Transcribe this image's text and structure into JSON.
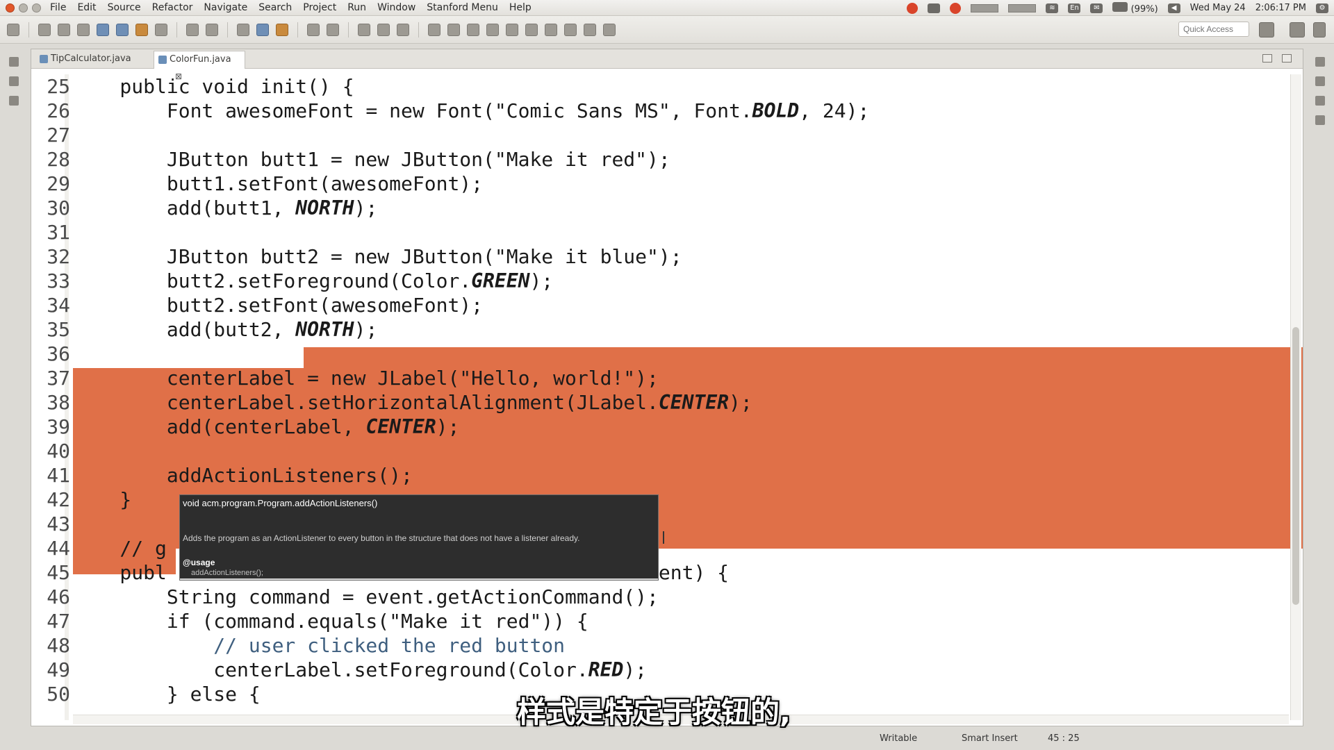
{
  "menubar": {
    "items": [
      "File",
      "Edit",
      "Source",
      "Refactor",
      "Navigate",
      "Search",
      "Project",
      "Run",
      "Window",
      "Stanford Menu",
      "Help"
    ],
    "battery": "(99%)",
    "date": "Wed May 24",
    "time": "2:06:17 PM"
  },
  "toolbar": {
    "quick_access_placeholder": "Quick Access"
  },
  "tabs": [
    {
      "label": "TipCalculator.java",
      "active": false
    },
    {
      "label": "ColorFun.java",
      "active": true,
      "close": "⊠"
    }
  ],
  "editor": {
    "line_numbers": [
      "25",
      "26",
      "27",
      "28",
      "29",
      "30",
      "31",
      "32",
      "33",
      "34",
      "35",
      "36",
      "37",
      "38",
      "39",
      "40",
      "41",
      "42",
      "43",
      "44",
      "45",
      "46",
      "47",
      "48",
      "49",
      "50"
    ],
    "lines": [
      {
        "plain": "    public void init() {"
      },
      {
        "plain": "        Font awesomeFont = new Font(\"Comic Sans MS\", Font.",
        "italic": "BOLD",
        "after": ", 24);"
      },
      {
        "plain": ""
      },
      {
        "plain": "        JButton butt1 = new JButton(\"Make it red\");"
      },
      {
        "plain": "        butt1.setFont(awesomeFont);"
      },
      {
        "plain": "        add(butt1, ",
        "italic": "NORTH",
        "after": ");"
      },
      {
        "plain": ""
      },
      {
        "plain": "        JButton butt2 = new JButton(\"Make it blue\");"
      },
      {
        "plain": "        butt2.setForeground(Color.",
        "italic": "GREEN",
        "after": ");"
      },
      {
        "plain": "        butt2.setFont(awesomeFont);"
      },
      {
        "plain": "        add(butt2, ",
        "italic": "NORTH",
        "after": ");"
      },
      {
        "plain": ""
      },
      {
        "plain": "        centerLabel = new JLabel(\"Hello, world!\");"
      },
      {
        "plain": "        centerLabel.setHorizontalAlignment(JLabel.",
        "italic": "CENTER",
        "after": ");"
      },
      {
        "plain": "        add(centerLabel, ",
        "italic": "CENTER",
        "after": ");"
      },
      {
        "plain": ""
      },
      {
        "plain": "        addActionListeners();"
      },
      {
        "plain": "    }"
      },
      {
        "plain": ""
      },
      {
        "plain": "    // g"
      },
      {
        "plain": "    publ",
        "after": "                                        event) {"
      },
      {
        "plain": "        String command = event.getActionCommand();"
      },
      {
        "plain": "        if (command.equals(\"Make it red\")) {"
      },
      {
        "plain": "            // user clicked the red button"
      },
      {
        "plain": "            centerLabel.setForeground(Color.",
        "italic": "RED",
        "after": ");"
      },
      {
        "plain": "        } else {"
      }
    ]
  },
  "tooltip": {
    "signature": "void acm.program.Program.addActionListeners()",
    "description": "Adds the program as an ActionListener to every button in the structure that does not have a listener already.",
    "usage_label": "@usage",
    "usage_code": "addActionListeners();"
  },
  "statusbar": {
    "mode": "Writable",
    "insert": "Smart Insert",
    "position": "45 : 25"
  },
  "subtitle": "样式是特定于按钮的,",
  "colors": {
    "selection": "#e07048",
    "tooltip_bg": "#2d2d2d",
    "close_button": "#e2572a"
  }
}
